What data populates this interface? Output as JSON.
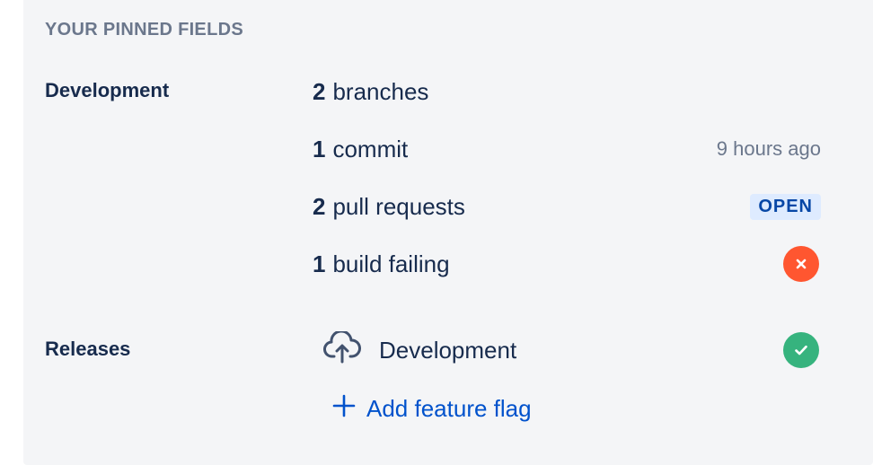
{
  "section": {
    "title": "YOUR PINNED FIELDS"
  },
  "development": {
    "label": "Development",
    "items": [
      {
        "count": "2",
        "text": "branches"
      },
      {
        "count": "1",
        "text": "commit",
        "meta": "9 hours ago"
      },
      {
        "count": "2",
        "text": "pull requests",
        "lozenge": "OPEN"
      },
      {
        "count": "1",
        "text": "build failing",
        "status": "failed"
      }
    ]
  },
  "releases": {
    "label": "Releases",
    "item": {
      "icon": "cloud-upload-icon",
      "text": "Development",
      "status": "success"
    },
    "add_link": "Add feature flag"
  },
  "colors": {
    "link": "#0052cc",
    "lozenge_bg": "#deebff",
    "fail": "#ff5630",
    "success": "#36b37e"
  }
}
